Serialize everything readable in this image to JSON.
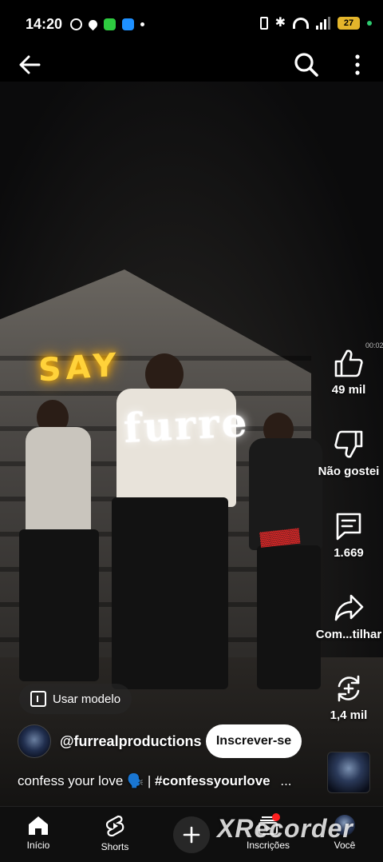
{
  "status_bar": {
    "time": "14:20",
    "battery": "27"
  },
  "video": {
    "sign_text": "SAY",
    "overlay_text": "furre",
    "timecode": "00:02"
  },
  "actions": {
    "like_count": "49 mil",
    "dislike_label": "Não gostei",
    "comments_count": "1.669",
    "share_label": "Com...tilhar",
    "remix_count": "1,4 mil"
  },
  "template_button": "Usar modelo",
  "channel": {
    "handle": "@furrealproductions",
    "subscribe_label": "Inscrever-se"
  },
  "caption": {
    "text": "confess your love 🗣️ | ",
    "hashtag": "#confessyourlove",
    "ellipsis": "..."
  },
  "bottom_nav": {
    "home": "Início",
    "shorts": "Shorts",
    "subscriptions": "Inscrições",
    "you": "Você"
  },
  "watermark": "XRecorder",
  "colors": {
    "accent_yellow": "#ffd23a",
    "subscribe_bg": "#ffffff",
    "battery": "#e4b52b",
    "record_dot": "#ff2020"
  }
}
